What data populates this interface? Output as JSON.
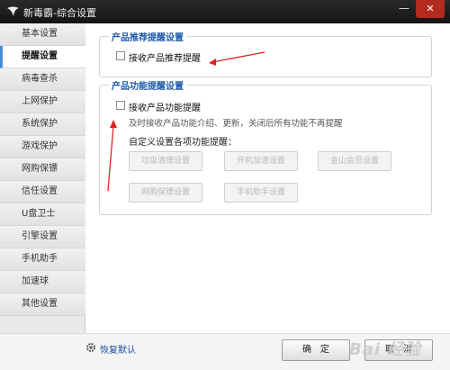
{
  "window": {
    "title": "新毒霸-综合设置",
    "minimize_glyph": "—",
    "close_glyph": "✕"
  },
  "sidebar": {
    "items": [
      {
        "label": "基本设置",
        "active": false
      },
      {
        "label": "提醒设置",
        "active": true
      },
      {
        "label": "病毒查杀",
        "active": false
      },
      {
        "label": "上网保护",
        "active": false
      },
      {
        "label": "系统保护",
        "active": false
      },
      {
        "label": "游戏保护",
        "active": false
      },
      {
        "label": "网购保镖",
        "active": false
      },
      {
        "label": "信任设置",
        "active": false
      },
      {
        "label": "U盘卫士",
        "active": false
      },
      {
        "label": "引擎设置",
        "active": false
      },
      {
        "label": "手机助手",
        "active": false
      },
      {
        "label": "加速球",
        "active": false
      },
      {
        "label": "其他设置",
        "active": false
      }
    ]
  },
  "recommend_group": {
    "title": "产品推荐提醒设置",
    "checkbox_label": "接收产品推荐提醒",
    "checked": false
  },
  "feature_group": {
    "title": "产品功能提醒设置",
    "checkbox_label": "接收产品功能提醒",
    "checked": false,
    "description": "及时接收产品功能介绍、更新，关闭后所有功能不再提醒",
    "custom_heading": "自定义设置各项功能提醒：",
    "buttons": [
      "垃圾清理设置",
      "开机加速设置",
      "金山会员设置",
      "网购保镖设置",
      "手机助手设置"
    ]
  },
  "footer": {
    "restore_label": "恢复默认",
    "ok_label": "确　定",
    "cancel_label": "取　消",
    "watermark": "Bai 经验"
  },
  "colors": {
    "accent": "#1d5aa8",
    "titlebar": "#1e1e1e",
    "close": "#b32b1e",
    "annotation_arrow": "#e02020"
  },
  "icons": {
    "app": "vortex-logo-icon",
    "restore": "gear-icon"
  }
}
